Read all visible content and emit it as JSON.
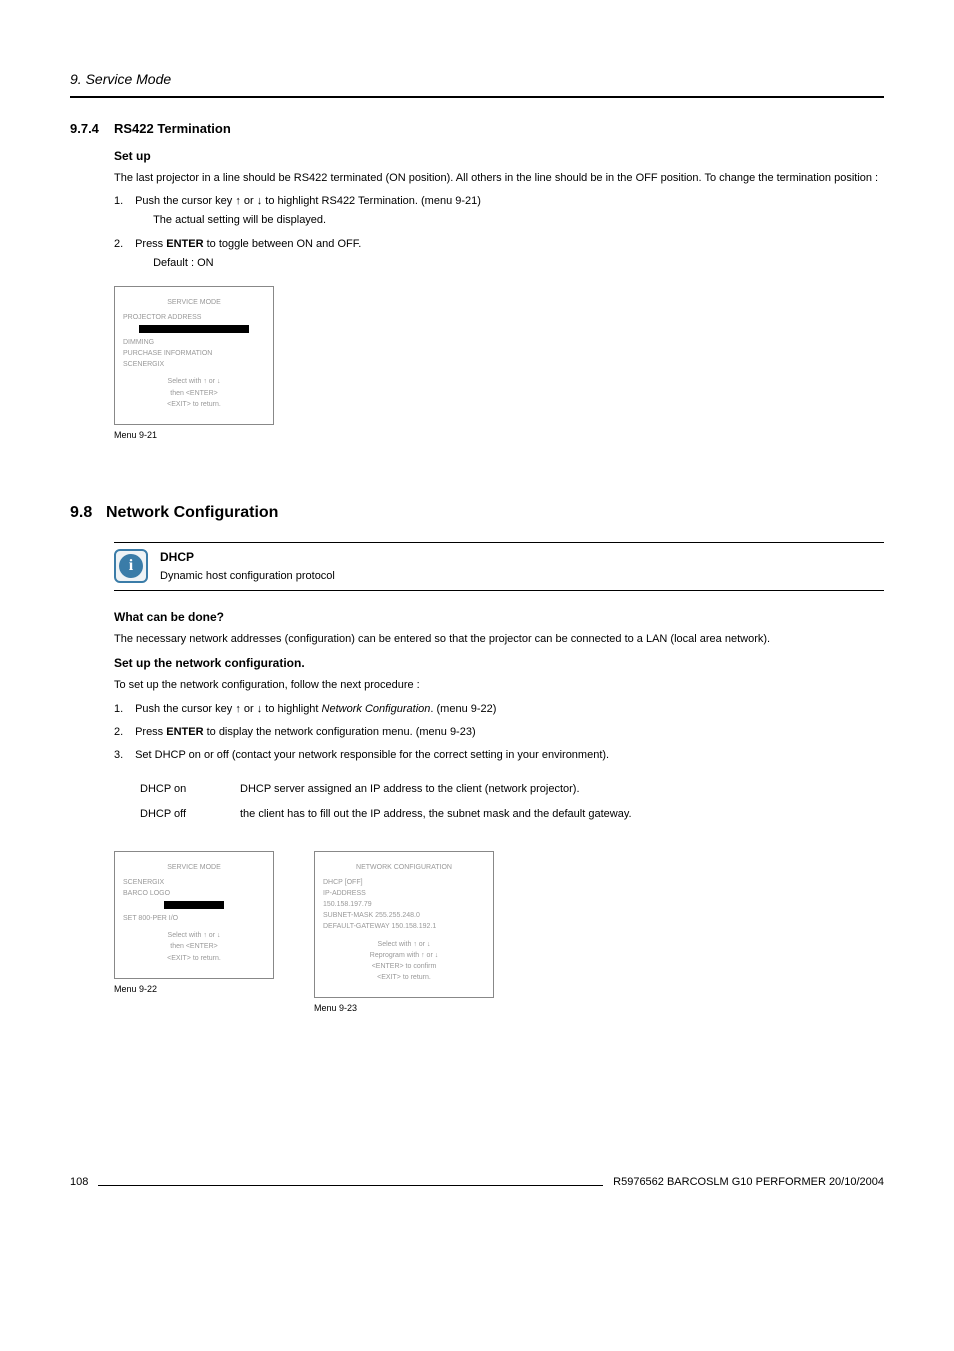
{
  "header": {
    "chapter": "9.  Service Mode"
  },
  "s974": {
    "number": "9.7.4",
    "title": "RS422 Termination",
    "setup_heading": "Set up",
    "intro": "The last projector in a line should be RS422 terminated (ON position). All others in the line should be in the OFF position. To change the termination position :",
    "step1_num": "1.",
    "step1": "Push the cursor key ↑ or ↓ to highlight RS422 Termination. (menu 9-21)",
    "step1_sub": "The actual setting will be displayed.",
    "step2_num": "2.",
    "step2_a": "Press ",
    "step2_b": "ENTER",
    "step2_c": " to toggle between ON and OFF.",
    "step2_sub": "Default :  ON",
    "menu921": {
      "title": "SERVICE MODE",
      "lines_top": "PROJECTOR ADDRESS",
      "lines_mid": "DIMMING\nPURCHASE INFORMATION\nSCENERGIX",
      "footer1": "Select with ↑ or ↓",
      "footer2": "then <ENTER>",
      "footer3": "<EXIT> to return.",
      "caption": "Menu 9-21"
    }
  },
  "s98": {
    "number": "9.8",
    "title": "Network Configuration",
    "info": {
      "term": "DHCP",
      "def": "Dynamic host configuration protocol"
    },
    "what_heading": "What can be done?",
    "what_para": "The necessary network addresses (configuration) can be entered so that the projector can be connected to a LAN (local area network).",
    "setup_heading": "Set up the network configuration.",
    "setup_intro": "To set up the network configuration, follow the next procedure :",
    "step1_num": "1.",
    "step1_a": "Push the cursor key ↑ or ↓ to highlight ",
    "step1_b": "Network Configuration",
    "step1_c": ". (menu 9-22)",
    "step2_num": "2.",
    "step2_a": "Press ",
    "step2_b": "ENTER",
    "step2_c": " to display the network configuration menu. (menu 9-23)",
    "step3_num": "3.",
    "step3": "Set DHCP on or off (contact your network responsible for the correct setting in your environment).",
    "dhcp_on_label": "DHCP on",
    "dhcp_on_desc": "DHCP server assigned an IP address to the client (network projector).",
    "dhcp_off_label": "DHCP off",
    "dhcp_off_desc": "the client has to fill out the IP address, the subnet mask and the default gateway.",
    "menu922": {
      "title": "SERVICE MODE",
      "lines_top": "SCENERGIX\nBARCO LOGO",
      "lines_mid": "SET 800-PER I/O",
      "footer1": "Select with ↑ or ↓",
      "footer2": "then <ENTER>",
      "footer3": "<EXIT> to return.",
      "caption": "Menu 9-22"
    },
    "menu923": {
      "title": "NETWORK CONFIGURATION",
      "body": "DHCP [OFF]\nIP-ADDRESS\n150.158.197.79\nSUBNET-MASK   255.255.248.0\nDEFAULT-GATEWAY 150.158.192.1",
      "footer1": "Select with ↑ or ↓",
      "footer2": "Reprogram with ↑ or ↓",
      "footer3": "<ENTER> to confirm",
      "footer4": "<EXIT> to return.",
      "caption": "Menu 9-23"
    }
  },
  "footer": {
    "page": "108",
    "doc": "R5976562  BARCOSLM G10 PERFORMER  20/10/2004"
  }
}
